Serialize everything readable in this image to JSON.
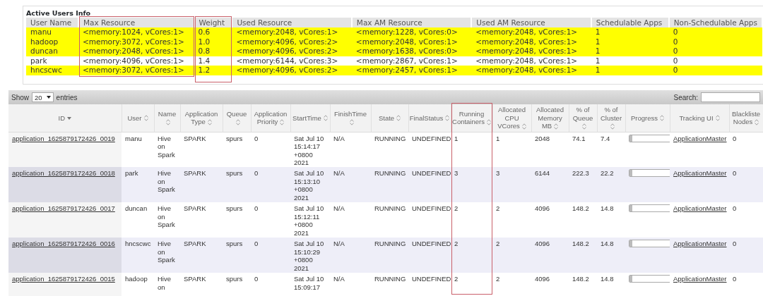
{
  "active_users": {
    "title": "Active Users Info",
    "columns": [
      {
        "label": "User Name",
        "highlighted": false
      },
      {
        "label": "Max Resource",
        "highlighted": true
      },
      {
        "label": "Weight",
        "highlighted": true
      },
      {
        "label": "Used Resource",
        "highlighted": false
      },
      {
        "label": "Max AM Resource",
        "highlighted": false
      },
      {
        "label": "Used AM Resource",
        "highlighted": false
      },
      {
        "label": "Schedulable Apps",
        "highlighted": false
      },
      {
        "label": "Non-Schedulable Apps",
        "highlighted": false
      }
    ],
    "rows": [
      {
        "highlighted": true,
        "cells": [
          "manu",
          "<memory:1024, vCores:1>",
          "0.6",
          "<memory:2048, vCores:1>",
          "<memory:1228, vCores:0>",
          "<memory:2048, vCores:1>",
          "1",
          "0"
        ]
      },
      {
        "highlighted": true,
        "cells": [
          "hadoop",
          "<memory:3072, vCores:1>",
          "1.0",
          "<memory:4096, vCores:2>",
          "<memory:2048, vCores:1>",
          "<memory:2048, vCores:1>",
          "1",
          "0"
        ]
      },
      {
        "highlighted": true,
        "cells": [
          "duncan",
          "<memory:2048, vCores:1>",
          "0.8",
          "<memory:4096, vCores:2>",
          "<memory:1638, vCores:0>",
          "<memory:2048, vCores:1>",
          "1",
          "0"
        ]
      },
      {
        "highlighted": false,
        "cells": [
          "park",
          "<memory:4096, vCores:1>",
          "1.4",
          "<memory:6144, vCores:3>",
          "<memory:2867, vCores:1>",
          "<memory:2048, vCores:1>",
          "1",
          "0"
        ]
      },
      {
        "highlighted": true,
        "cells": [
          "hncscwc",
          "<memory:3072, vCores:1>",
          "1.2",
          "<memory:4096, vCores:2>",
          "<memory:2457, vCores:1>",
          "<memory:2048, vCores:1>",
          "1",
          "0"
        ]
      }
    ]
  },
  "applications": {
    "show_label": "Show",
    "page_size": "20",
    "entries_label": "entries",
    "search_label": "Search:",
    "columns": [
      {
        "label": "ID",
        "kind": "link",
        "sorted": true,
        "highlighted": false
      },
      {
        "label": "User",
        "kind": "text",
        "sorted": false,
        "highlighted": false
      },
      {
        "label": "Name",
        "kind": "text",
        "sorted": false,
        "highlighted": false
      },
      {
        "label": "Application Type",
        "kind": "text",
        "sorted": false,
        "highlighted": false
      },
      {
        "label": "Queue",
        "kind": "text",
        "sorted": false,
        "highlighted": false
      },
      {
        "label": "Application Priority",
        "kind": "text",
        "sorted": false,
        "highlighted": false
      },
      {
        "label": "StartTime",
        "kind": "text",
        "sorted": false,
        "highlighted": false
      },
      {
        "label": "FinishTime",
        "kind": "text",
        "sorted": false,
        "highlighted": false
      },
      {
        "label": "State",
        "kind": "text",
        "sorted": false,
        "highlighted": false
      },
      {
        "label": "FinalStatus",
        "kind": "text",
        "sorted": false,
        "highlighted": false
      },
      {
        "label": "Running Containers",
        "kind": "text",
        "sorted": false,
        "highlighted": true
      },
      {
        "label": "Allocated CPU VCores",
        "kind": "text",
        "sorted": false,
        "highlighted": false
      },
      {
        "label": "Allocated Memory MB",
        "kind": "text",
        "sorted": false,
        "highlighted": false
      },
      {
        "label": "% of Queue",
        "kind": "text",
        "sorted": false,
        "highlighted": false
      },
      {
        "label": "% of Cluster",
        "kind": "text",
        "sorted": false,
        "highlighted": false
      },
      {
        "label": "Progress",
        "kind": "progress",
        "sorted": false,
        "highlighted": false
      },
      {
        "label": "Tracking UI",
        "kind": "link",
        "sorted": false,
        "highlighted": false
      },
      {
        "label": "Blackliste Nodes",
        "kind": "text",
        "sorted": false,
        "highlighted": false
      }
    ],
    "rows": [
      {
        "cells": [
          "application_1625879172426_0019",
          "manu",
          "Hive on Spark",
          "SPARK",
          "spurs",
          "0",
          "Sat Jul 10 15:14:17 +0800 2021",
          "N/A",
          "RUNNING",
          "UNDEFINED",
          "1",
          "1",
          "2048",
          "74.1",
          "7.4",
          {
            "level": 0.06
          },
          "ApplicationMaster",
          "0"
        ]
      },
      {
        "cells": [
          "application_1625879172426_0018",
          "park",
          "Hive on Spark",
          "SPARK",
          "spurs",
          "0",
          "Sat Jul 10 15:13:10 +0800 2021",
          "N/A",
          "RUNNING",
          "UNDEFINED",
          "3",
          "3",
          "6144",
          "222.3",
          "22.2",
          {
            "level": 0.06
          },
          "ApplicationMaster",
          "0"
        ]
      },
      {
        "cells": [
          "application_1625879172426_0017",
          "duncan",
          "Hive on Spark",
          "SPARK",
          "spurs",
          "0",
          "Sat Jul 10 15:12:11 +0800 2021",
          "N/A",
          "RUNNING",
          "UNDEFINED",
          "2",
          "2",
          "4096",
          "148.2",
          "14.8",
          {
            "level": 0.06
          },
          "ApplicationMaster",
          "0"
        ]
      },
      {
        "cells": [
          "application_1625879172426_0016",
          "hncscwc",
          "Hive on Spark",
          "SPARK",
          "spurs",
          "0",
          "Sat Jul 10 15:10:29 +0800 2021",
          "N/A",
          "RUNNING",
          "UNDEFINED",
          "2",
          "2",
          "4096",
          "148.2",
          "14.8",
          {
            "level": 0.06
          },
          "ApplicationMaster",
          "0"
        ]
      },
      {
        "cells": [
          "application_1625879172426_0015",
          "hadoop",
          "Hive on",
          "SPARK",
          "spurs",
          "0",
          "Sat Jul 10 15:09:17",
          "N/A",
          "RUNNING",
          "UNDEFINED",
          "2",
          "2",
          "4096",
          "148.2",
          "14.8",
          {
            "level": 0.06
          },
          "ApplicationMaster",
          "0"
        ]
      }
    ]
  }
}
